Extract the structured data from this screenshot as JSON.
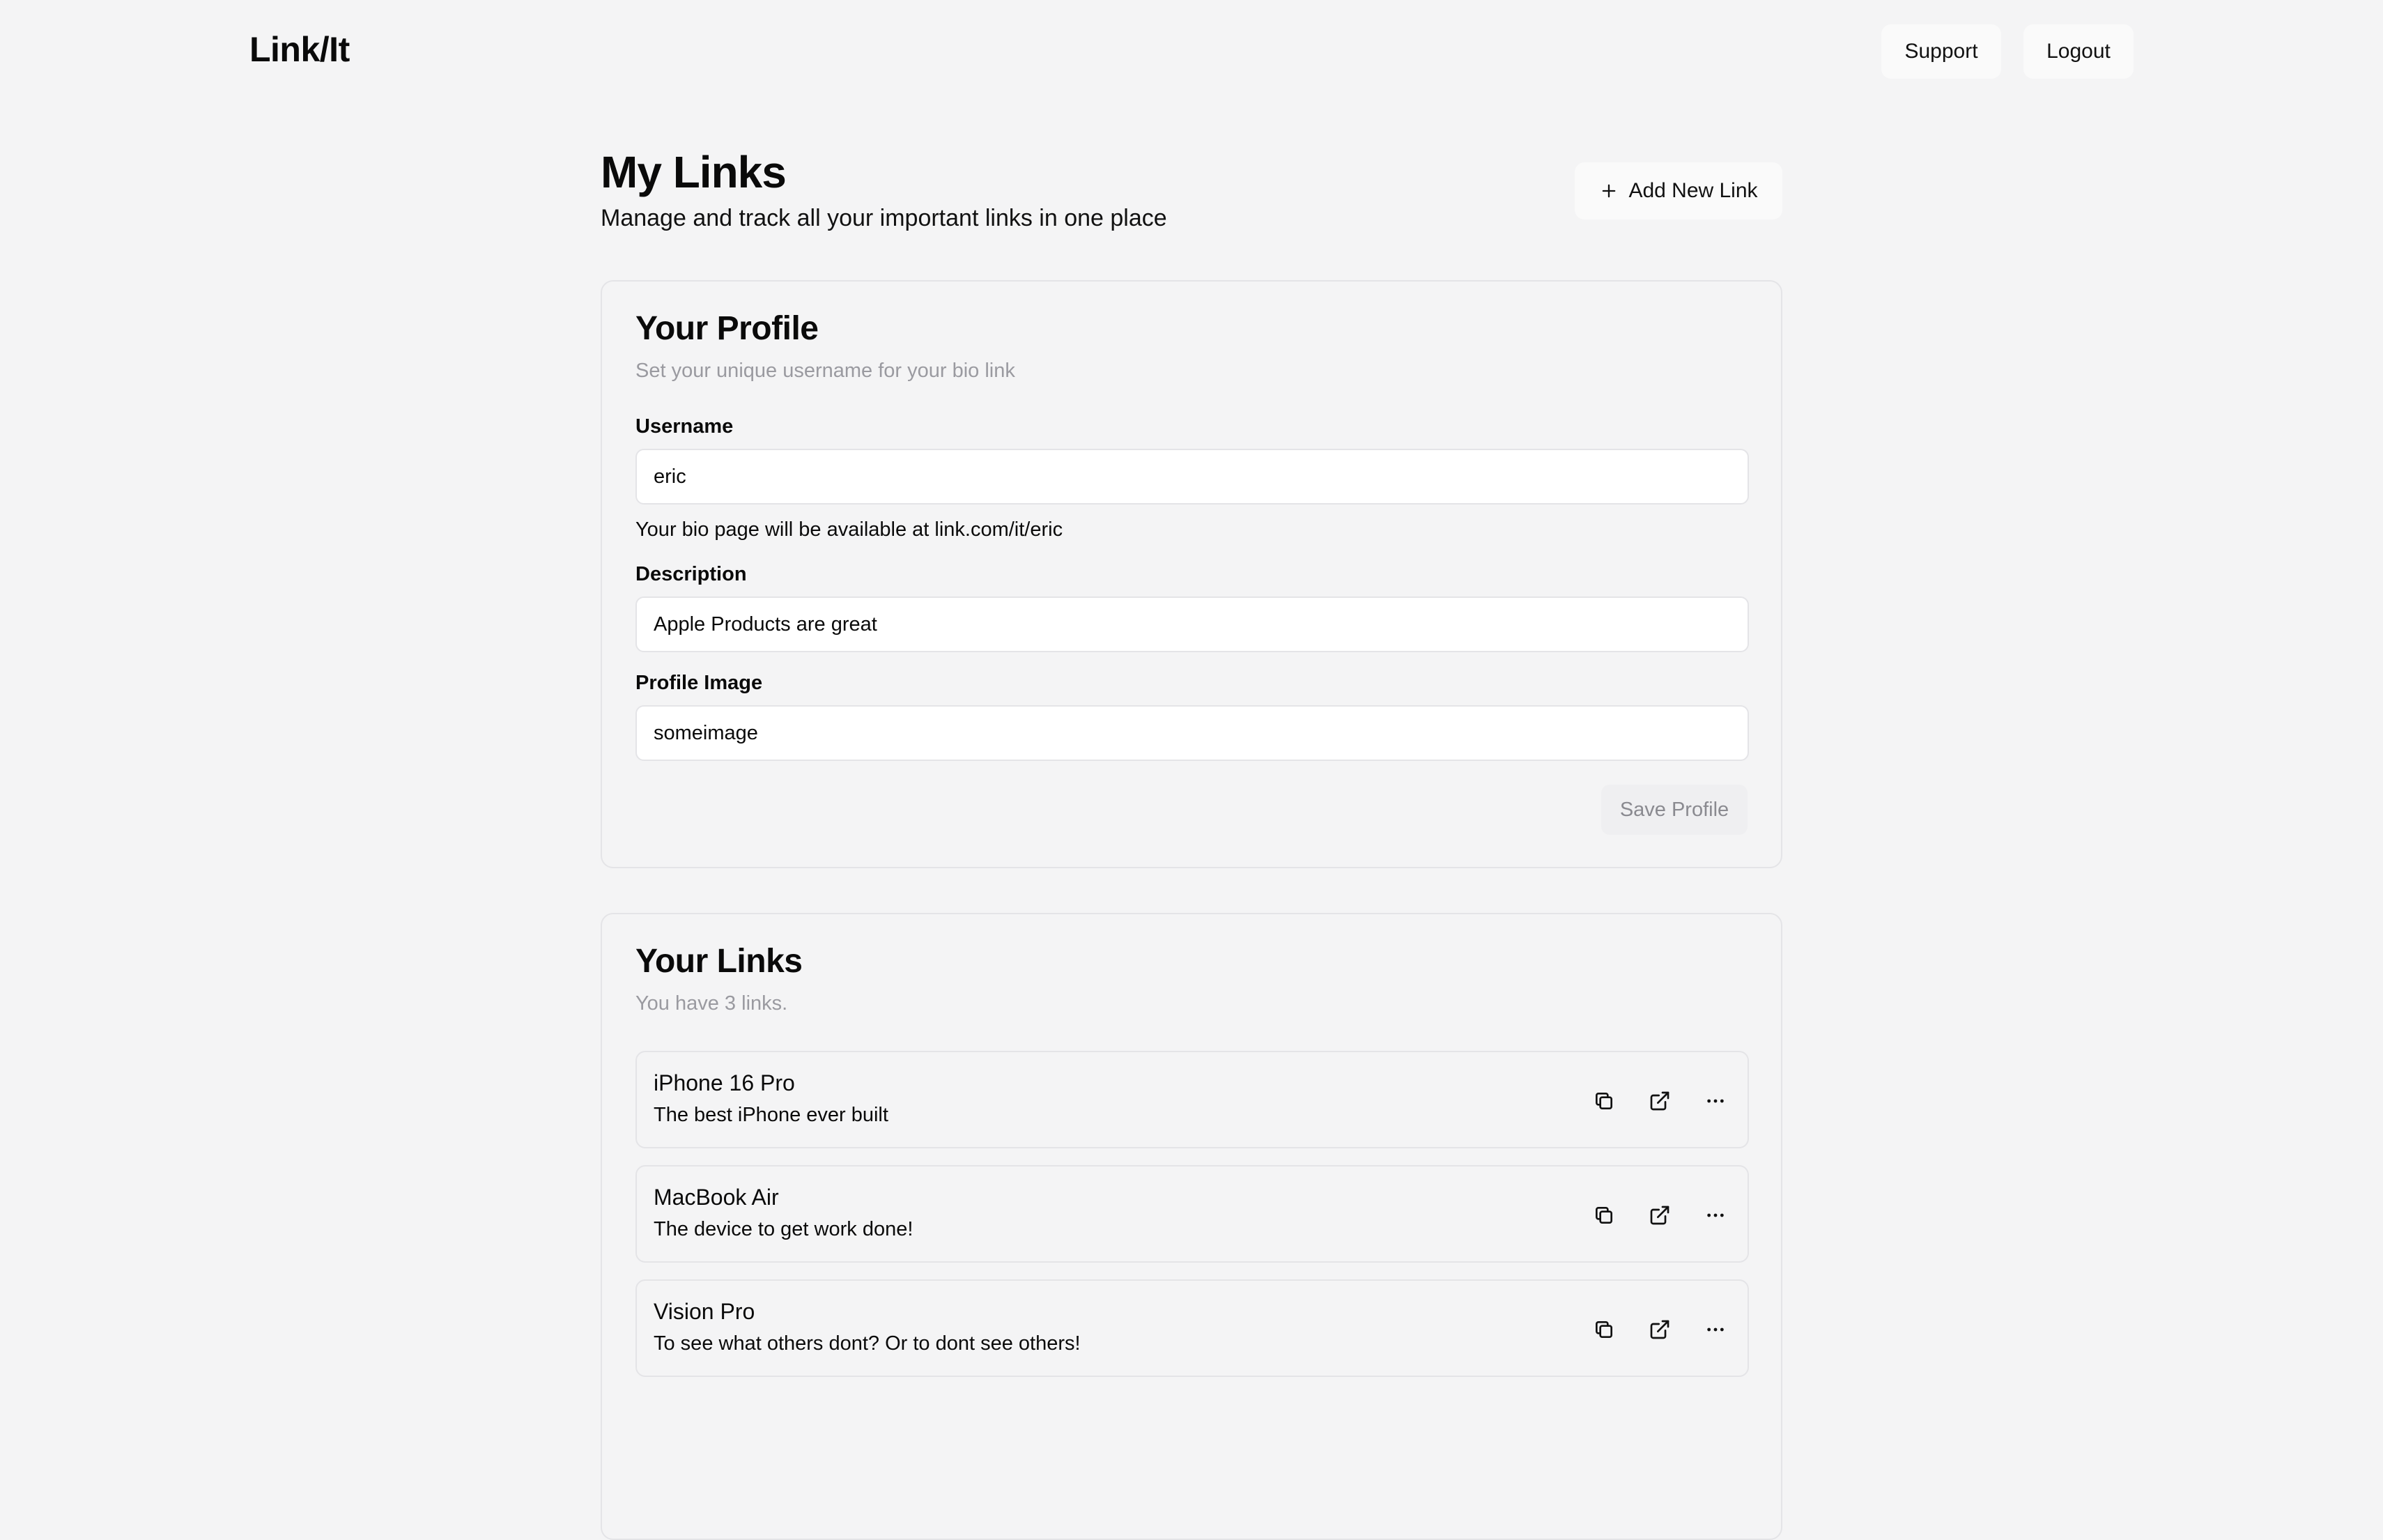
{
  "app": {
    "brand": "Link/It"
  },
  "nav": {
    "support_label": "Support",
    "logout_label": "Logout"
  },
  "page": {
    "title": "My Links",
    "subtitle": "Manage and track all your important links in one place",
    "add_button_label": "Add New Link"
  },
  "profile": {
    "title": "Your Profile",
    "description": "Set your unique username for your bio link",
    "username_label": "Username",
    "username_value": "eric",
    "username_hint": "Your bio page will be available at link.com/it/eric",
    "description_label": "Description",
    "description_value": "Apple Products are great",
    "image_label": "Profile Image",
    "image_value": "someimage",
    "save_label": "Save Profile"
  },
  "links": {
    "title": "Your Links",
    "count_text": "You have 3 links.",
    "items": [
      {
        "title": "iPhone 16 Pro",
        "description": "The best iPhone ever built"
      },
      {
        "title": "MacBook Air",
        "description": "The device to get work done!"
      },
      {
        "title": "Vision Pro",
        "description": "To see what others dont? Or to dont see others!"
      }
    ]
  }
}
